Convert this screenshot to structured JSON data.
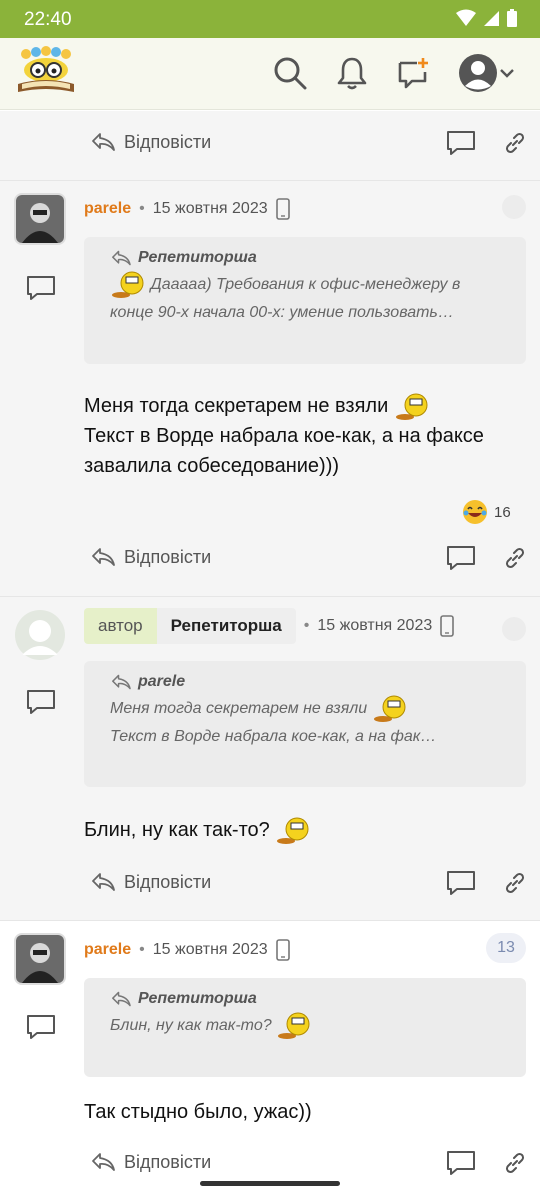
{
  "status_bar": {
    "time": "22:40"
  },
  "actions": {
    "reply_label": "Відповісти"
  },
  "posts": [
    {
      "username": "parele",
      "date": "15 жовтня 2023",
      "quote_author": "Репетиторша",
      "quote_line1": "Дааааа) Требования к офис-менеджеру в",
      "quote_line2": "конце 90-х начала 00-х: умение пользовать…",
      "body_line1": "Меня тогда секретарем не взяли",
      "body_line2": "Текст в Ворде набрала кое-как, а на факсе",
      "body_line3": "завалила собеседование)))",
      "reaction_count": "16"
    },
    {
      "author_tag": "автор",
      "username": "Репетиторша",
      "date": "15 жовтня 2023",
      "quote_author": "parele",
      "quote_line1": "Меня тогда секретарем не взяли",
      "quote_line2": "Текст в Ворде набрала кое-как, а на фак…",
      "body_line1": "Блин, ну как так-то?"
    },
    {
      "username": "parele",
      "date": "15 жовтня 2023",
      "post_number": "13",
      "quote_author": "Репетиторша",
      "quote_line1": "Блин, ну как так-то?",
      "body_line1": "Так стыдно было, ужас))"
    }
  ],
  "colors": {
    "status_bar": "#8bb33a",
    "username": "#e07a1a",
    "author_tag_bg": "#e6f0c9"
  }
}
